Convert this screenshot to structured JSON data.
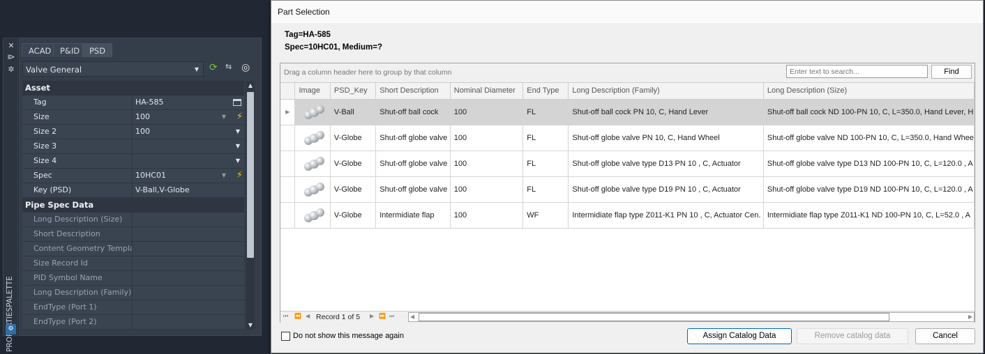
{
  "palette": {
    "vertical_title": "PROPERTIESPALETTE",
    "tabs": [
      "ACAD",
      "P&ID",
      "PSD"
    ],
    "active_tab": "PSD",
    "object_type": "Valve General",
    "categories": [
      {
        "name": "Asset",
        "rows": [
          {
            "label": "Tag",
            "value": "HA-585"
          },
          {
            "label": "Size",
            "value": "100"
          },
          {
            "label": "Size 2",
            "value": "100"
          },
          {
            "label": "Size 3",
            "value": ""
          },
          {
            "label": "Size 4",
            "value": ""
          },
          {
            "label": "Spec",
            "value": "10HC01"
          },
          {
            "label": "Key (PSD)",
            "value": "V-Ball,V-Globe"
          }
        ]
      },
      {
        "name": "Pipe Spec Data",
        "rows": [
          {
            "label": "Long Description (Size)",
            "value": ""
          },
          {
            "label": "Short Description",
            "value": ""
          },
          {
            "label": "Content Geometry Template",
            "value": ""
          },
          {
            "label": "Size Record Id",
            "value": ""
          },
          {
            "label": "PID Symbol Name",
            "value": ""
          },
          {
            "label": "Long Description (Family)",
            "value": ""
          },
          {
            "label": "EndType (Port 1)",
            "value": ""
          },
          {
            "label": "EndType (Port 2)",
            "value": ""
          }
        ]
      }
    ]
  },
  "dialog": {
    "title": "Part Selection",
    "tag_line": "Tag=HA-585",
    "spec_line": "Spec=10HC01, Medium=?",
    "group_hint": "Drag a column header here to group by that column",
    "search_placeholder": "Enter text to search...",
    "find_label": "Find",
    "columns": [
      "Image",
      "PSD_Key",
      "Short Description",
      "Nominal Diameter",
      "End Type",
      "Long Description (Family)",
      "Long Description (Size)"
    ],
    "rows": [
      {
        "psd_key": "V-Ball",
        "short": "Shut-off ball cock",
        "nd": "100",
        "end": "FL",
        "family": "Shut-off ball cock PN 10, C, Hand Lever",
        "size": "Shut-off ball cock ND 100-PN 10, C, L=350.0, Hand Lever, H",
        "selected": true
      },
      {
        "psd_key": "V-Globe",
        "short": "Shut-off globe valve",
        "nd": "100",
        "end": "FL",
        "family": "Shut-off globe valve PN 10, C, Hand Wheel",
        "size": "Shut-off globe valve ND 100-PN 10, C, L=350.0, Hand Whee"
      },
      {
        "psd_key": "V-Globe",
        "short": "Shut-off globe valve",
        "nd": "100",
        "end": "FL",
        "family": "Shut-off globe valve type D13 PN 10 , C, Actuator",
        "size": "Shut-off globe valve type D13 ND 100-PN 10, C, L=120.0 , A"
      },
      {
        "psd_key": "V-Globe",
        "short": "Shut-off globe valve",
        "nd": "100",
        "end": "FL",
        "family": "Shut-off globe valve type D19 PN 10 , C, Actuator",
        "size": "Shut-off globe valve type D19 ND 100-PN 10, C, L=120.0 , A"
      },
      {
        "psd_key": "V-Globe",
        "short": "Intermidiate flap",
        "nd": "100",
        "end": "WF",
        "family": "Intermidiate flap type Z011-K1 PN 10 , C, Actuator Cen.",
        "size": "Intermidiate flap type Z011-K1 ND 100-PN 10, C, L=52.0 , A"
      }
    ],
    "record_text": "Record 1 of 5",
    "checkbox_label": "Do not show this message again",
    "assign_label": "Assign Catalog Data",
    "remove_label": "Remove catalog data",
    "cancel_label": "Cancel"
  }
}
